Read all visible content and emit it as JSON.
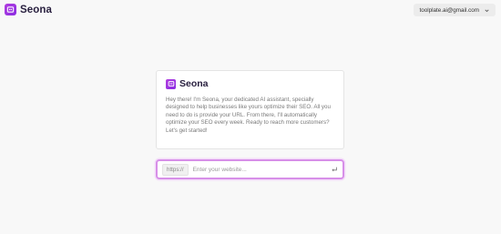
{
  "header": {
    "brand": "Seona",
    "account_email": "toolplate.ai@gmail.com",
    "account_icon": "chevron-down-icon"
  },
  "card": {
    "brand": "Seona",
    "message": "Hey there! I'm Seona, your dedicated AI assistant, specially designed to help businesses like yours optimize their SEO. All you need to do is provide your URL. From there, I'll automatically optimize your SEO every week. Ready to reach more customers? Let's get started!"
  },
  "url_bar": {
    "prefix": "https://",
    "placeholder": "Enter your website...",
    "submit_icon": "enter-icon"
  },
  "colors": {
    "brand": "#9b35e0",
    "focus_border": "#d78fe8"
  }
}
